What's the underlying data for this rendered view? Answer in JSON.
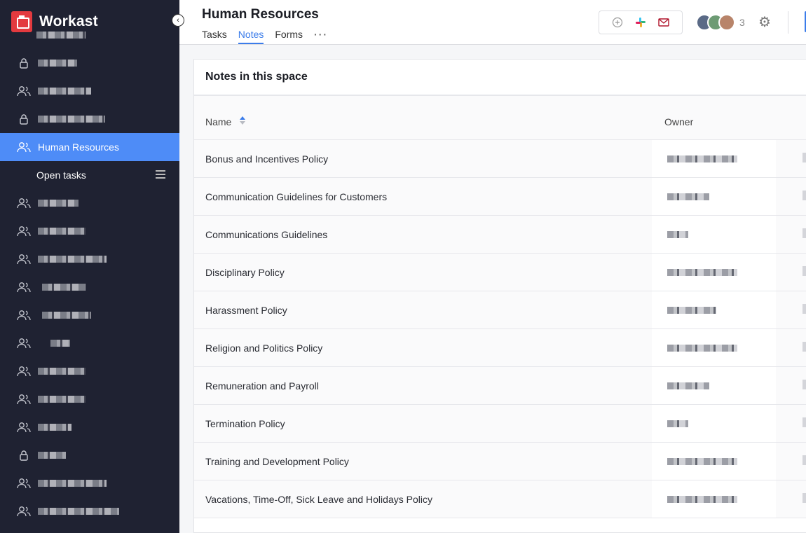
{
  "app": {
    "name": "Workast"
  },
  "sidebar": {
    "items": [
      {
        "type": "private",
        "label": ""
      },
      {
        "type": "team",
        "label": ""
      },
      {
        "type": "private",
        "label": ""
      },
      {
        "type": "team",
        "label": "Human Resources",
        "active": true
      }
    ],
    "sub_item": {
      "label": "Open tasks"
    },
    "more_items": [
      {
        "type": "team"
      },
      {
        "type": "team"
      },
      {
        "type": "team"
      },
      {
        "type": "team"
      },
      {
        "type": "team"
      },
      {
        "type": "team"
      },
      {
        "type": "team"
      },
      {
        "type": "team"
      },
      {
        "type": "team"
      },
      {
        "type": "private"
      },
      {
        "type": "team"
      },
      {
        "type": "team"
      }
    ]
  },
  "header": {
    "title": "Human Resources",
    "tabs": [
      {
        "label": "Tasks"
      },
      {
        "label": "Notes",
        "active": true
      },
      {
        "label": "Forms"
      }
    ],
    "more_tabs_label": "···",
    "integrations": [
      "add-integration-icon",
      "slack-icon",
      "email-icon"
    ],
    "member_count": "3"
  },
  "notes": {
    "panel_title": "Notes in this space",
    "columns": {
      "name": "Name",
      "owner": "Owner"
    },
    "rows": [
      {
        "name": "Bonus and Incentives Policy"
      },
      {
        "name": "Communication Guidelines for Customers"
      },
      {
        "name": "Communications Guidelines"
      },
      {
        "name": "Disciplinary Policy"
      },
      {
        "name": "Harassment Policy"
      },
      {
        "name": "Religion and Politics Policy"
      },
      {
        "name": "Remuneration and Payroll"
      },
      {
        "name": "Termination Policy"
      },
      {
        "name": "Training and Development Policy"
      },
      {
        "name": "Vacations, Time-Off, Sick Leave and Holidays Policy"
      }
    ]
  },
  "colors": {
    "accent": "#3b7cea",
    "sidebar_bg": "#1f2232",
    "active_item": "#4e8cf7",
    "brand": "#e33a3f"
  }
}
